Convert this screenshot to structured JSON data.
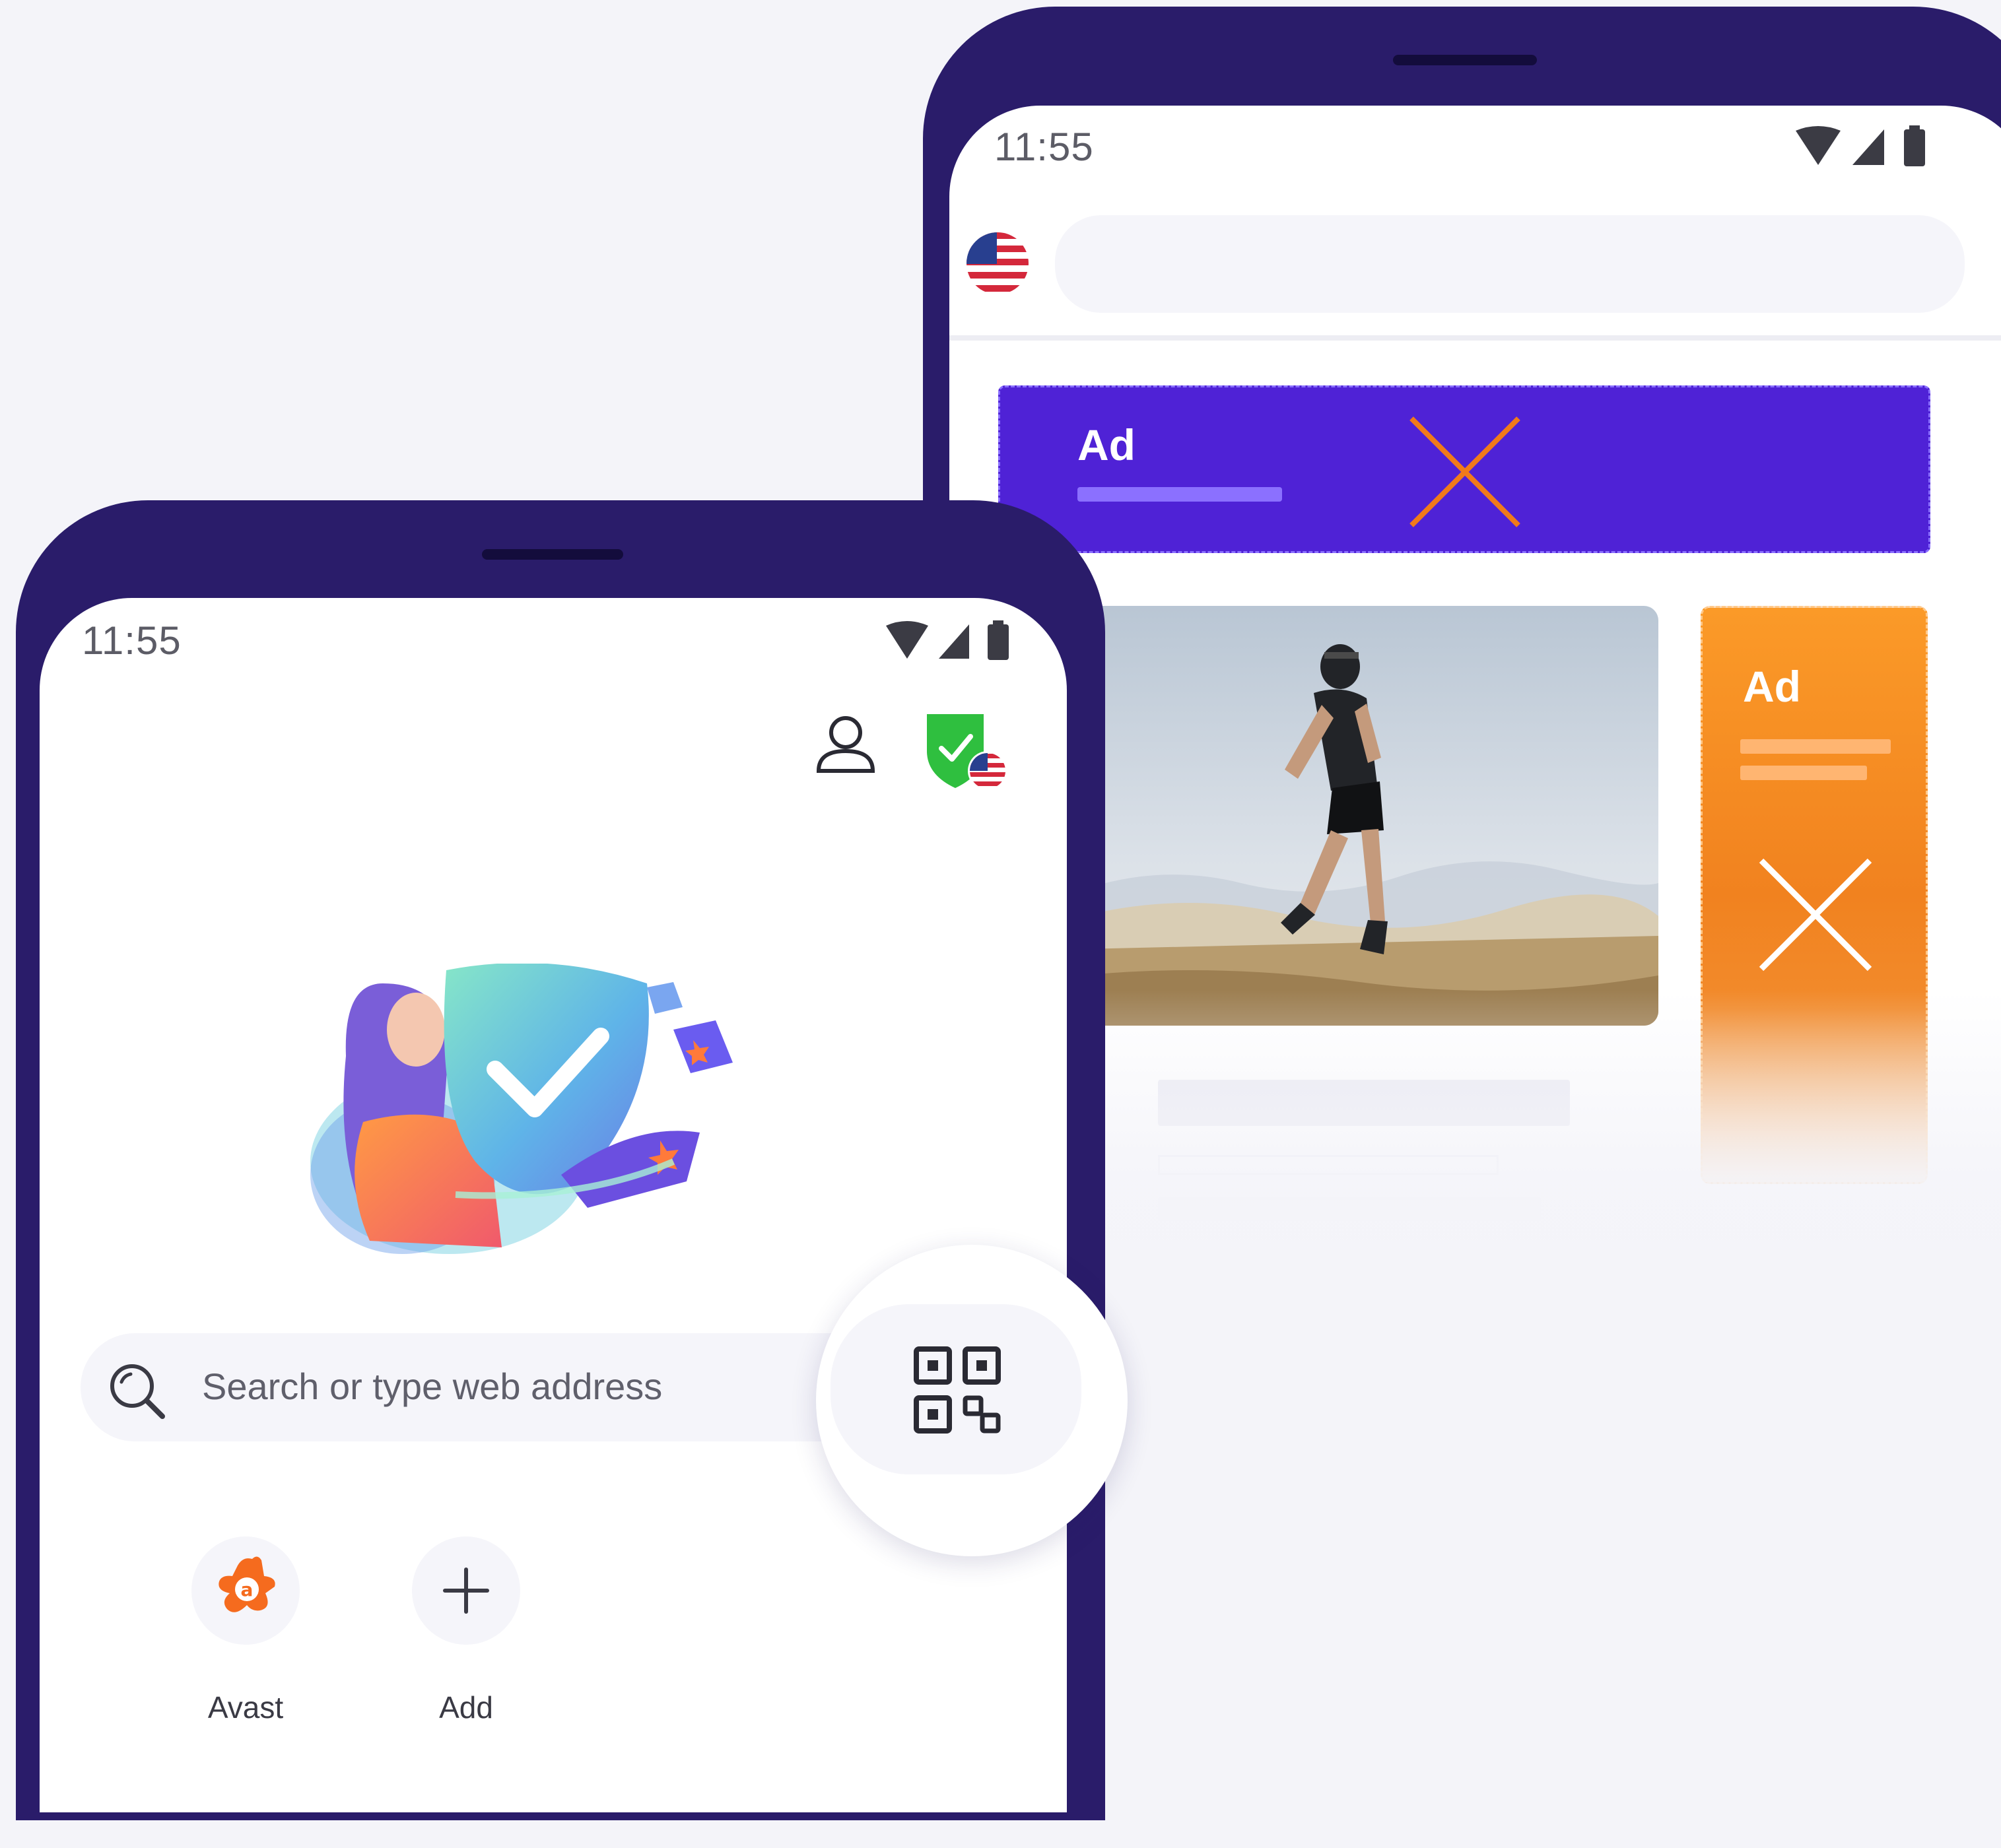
{
  "back_phone": {
    "status": {
      "time": "11:55",
      "wifi_icon": "wifi-icon",
      "signal_icon": "signal-icon",
      "battery_icon": "battery-icon"
    },
    "address_bar": {
      "region_icon": "us-flag-icon",
      "placeholder": ""
    },
    "banner_ad": {
      "label": "Ad",
      "close_icon": "close-x-icon",
      "accent_color": "#4f22d6",
      "x_color": "#f17a1a"
    },
    "content_image": "runner-photo",
    "side_ad": {
      "label": "Ad",
      "close_icon": "close-x-icon",
      "accent_color": "#f5841f"
    }
  },
  "front_phone": {
    "status": {
      "time": "11:55",
      "wifi_icon": "wifi-icon",
      "signal_icon": "signal-icon",
      "battery_icon": "battery-icon"
    },
    "header": {
      "profile_icon": "user-icon",
      "vpn_icon": "shield-check-icon",
      "vpn_color": "#2fbf3f"
    },
    "hero_illustration": "woman-holding-shield-illustration",
    "search": {
      "icon": "search-icon",
      "placeholder": "Search or type web address",
      "qr_icon": "qr-code-icon"
    },
    "shortcuts": [
      {
        "label": "Avast",
        "icon": "avast-logo-icon"
      },
      {
        "label": "Add",
        "icon": "plus-icon"
      }
    ]
  }
}
